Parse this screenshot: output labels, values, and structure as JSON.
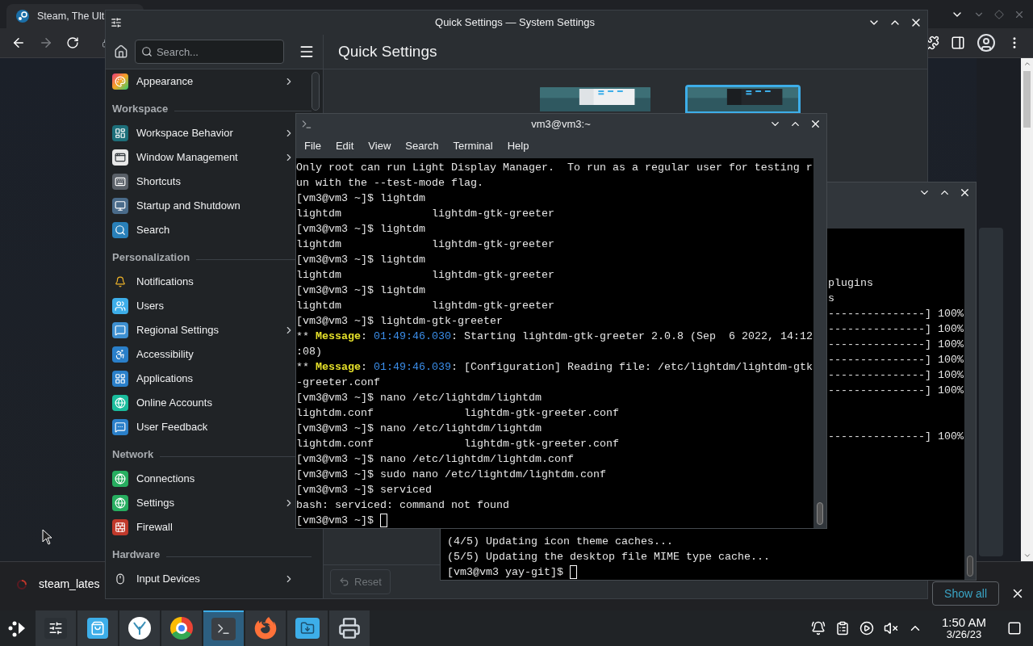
{
  "browser": {
    "tab_title": "Steam, The Ult",
    "download": "steam_lates",
    "show_all_button": "Show all"
  },
  "settings_window": {
    "title": "Quick Settings — System Settings",
    "search": {
      "placeholder": "Search..."
    },
    "page_title": "Quick Settings",
    "groups": [
      {
        "items": [
          {
            "label": "Appearance",
            "expandable": true
          }
        ]
      },
      {
        "title": "Workspace",
        "items": [
          {
            "label": "Workspace Behavior",
            "expandable": true
          },
          {
            "label": "Window Management",
            "expandable": true
          },
          {
            "label": "Shortcuts",
            "expandable": false
          },
          {
            "label": "Startup and Shutdown",
            "expandable": false
          },
          {
            "label": "Search",
            "expandable": false
          }
        ]
      },
      {
        "title": "Personalization",
        "items": [
          {
            "label": "Notifications",
            "expandable": false
          },
          {
            "label": "Users",
            "expandable": false
          },
          {
            "label": "Regional Settings",
            "expandable": true
          },
          {
            "label": "Accessibility",
            "expandable": false
          },
          {
            "label": "Applications",
            "expandable": false
          },
          {
            "label": "Online Accounts",
            "expandable": false
          },
          {
            "label": "User Feedback",
            "expandable": false
          }
        ]
      },
      {
        "title": "Network",
        "items": [
          {
            "label": "Connections",
            "expandable": false
          },
          {
            "label": "Settings",
            "expandable": true
          },
          {
            "label": "Firewall",
            "expandable": false
          }
        ]
      },
      {
        "title": "Hardware",
        "items": [
          {
            "label": "Input Devices",
            "expandable": true
          }
        ]
      }
    ],
    "themes": [
      {
        "selected": false
      },
      {
        "selected": true
      }
    ],
    "reset_button": {
      "label": "Reset",
      "disabled": true
    }
  },
  "terminal": {
    "title": "vm3@vm3:~",
    "menu": [
      "File",
      "Edit",
      "View",
      "Search",
      "Terminal",
      "Help"
    ],
    "lines": [
      {
        "text": "Only root can run Light Display Manager.  To run as a regular user for testing r"
      },
      {
        "text": "un with the --test-mode flag."
      },
      {
        "text": "[vm3@vm3 ~]$ lightdm"
      },
      {
        "text": "lightdm              lightdm-gtk-greeter"
      },
      {
        "text": "[vm3@vm3 ~]$ lightdm"
      },
      {
        "text": "lightdm              lightdm-gtk-greeter"
      },
      {
        "text": "[vm3@vm3 ~]$ lightdm"
      },
      {
        "text": "lightdm              lightdm-gtk-greeter"
      },
      {
        "text": "[vm3@vm3 ~]$ lightdm"
      },
      {
        "text": "lightdm              lightdm-gtk-greeter"
      },
      {
        "text": "[vm3@vm3 ~]$ lightdm-gtk-greeter"
      },
      {
        "parts": [
          {
            "text": "** ",
            "kind": "plain"
          },
          {
            "text": "Message",
            "kind": "label"
          },
          {
            "text": ": ",
            "kind": "plain"
          },
          {
            "text": "01:49:46.030",
            "kind": "time"
          },
          {
            "text": ": Starting lightdm-gtk-greeter 2.0.8 (Sep  6 2022, 14:12",
            "kind": "plain"
          }
        ]
      },
      {
        "text": ":08)"
      },
      {
        "parts": [
          {
            "text": "** ",
            "kind": "plain"
          },
          {
            "text": "Message",
            "kind": "label"
          },
          {
            "text": ": ",
            "kind": "plain"
          },
          {
            "text": "01:49:46.039",
            "kind": "time"
          },
          {
            "text": ": [Configuration] Reading file: /etc/lightdm/lightdm-gtk",
            "kind": "plain"
          }
        ]
      },
      {
        "text": "-greeter.conf"
      },
      {
        "text": "[vm3@vm3 ~]$ nano /etc/lightdm/lightdm"
      },
      {
        "text": "lightdm.conf              lightdm-gtk-greeter.conf"
      },
      {
        "text": "[vm3@vm3 ~]$ nano /etc/lightdm/lightdm"
      },
      {
        "text": "lightdm.conf              lightdm-gtk-greeter.conf"
      },
      {
        "text": "[vm3@vm3 ~]$ nano /etc/lightdm/lightdm.conf"
      },
      {
        "text": "[vm3@vm3 ~]$ sudo nano /etc/lightdm/lightdm.conf"
      },
      {
        "text": "[vm3@vm3 ~]$ serviced"
      },
      {
        "text": "bash: serviced: command not found"
      },
      {
        "text": "[vm3@vm3 ~]$ "
      }
    ]
  },
  "background_terminal": {
    "side_lines": [
      "plugins",
      "s",
      "---------------] 100%",
      "---------------] 100%",
      "---------------] 100%",
      "---------------] 100%",
      "---------------] 100%",
      "---------------] 100%"
    ],
    "side_lines_after_gap": [
      "---------------] 100%"
    ],
    "bottom_lines": [
      "(4/5) Updating icon theme caches...",
      "(5/5) Updating the desktop file MIME type cache...",
      "[vm3@vm3 yay-git]$ "
    ]
  },
  "taskbar": {
    "tasks": [
      {
        "selected": false
      },
      {
        "selected": false
      },
      {
        "selected": false
      },
      {
        "selected": false
      },
      {
        "selected": true
      },
      {
        "selected": false
      },
      {
        "selected": false
      },
      {
        "selected": false
      }
    ],
    "clock": {
      "time": "1:50 AM",
      "date": "3/26/23"
    }
  }
}
